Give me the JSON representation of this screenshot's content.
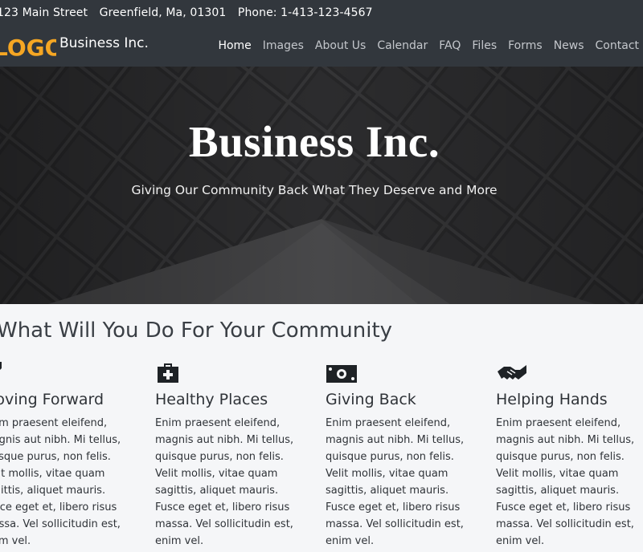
{
  "topbar": {
    "address": "123 Main Street",
    "city": "Greenfield, Ma, 01301",
    "phone": "Phone: 1-413-123-4567"
  },
  "brand": {
    "logo_text": "LOGO",
    "name": "Business Inc."
  },
  "nav": {
    "items": [
      "Home",
      "Images",
      "About Us",
      "Calendar",
      "FAQ",
      "Files",
      "Forms",
      "News",
      "Contact"
    ],
    "active": "Home"
  },
  "hero": {
    "title": "Business Inc.",
    "subtitle": "Giving Our Community Back What They Deserve and More"
  },
  "features": {
    "heading": "What Will You Do For Your Community",
    "items": [
      {
        "icon": "key-icon",
        "title": "Moving Forward",
        "text": "Enim praesent eleifend, magnis aut nibh. Mi tellus, quisque purus, non felis. Velit mollis, vitae quam sagittis, aliquet mauris. Fusce eget et, libero risus massa. Vel sollicitudin est, enim vel."
      },
      {
        "icon": "first-aid-kit-icon",
        "title": "Healthy Places",
        "text": "Enim praesent eleifend, magnis aut nibh. Mi tellus, quisque purus, non felis. Velit mollis, vitae quam sagittis, aliquet mauris. Fusce eget et, libero risus massa. Vel sollicitudin est, enim vel."
      },
      {
        "icon": "money-bill-icon",
        "title": "Giving Back",
        "text": "Enim praesent eleifend, magnis aut nibh. Mi tellus, quisque purus, non felis. Velit mollis, vitae quam sagittis, aliquet mauris. Fusce eget et, libero risus massa. Vel sollicitudin est, enim vel."
      },
      {
        "icon": "handshake-icon",
        "title": "Helping Hands",
        "text": "Enim praesent eleifend, magnis aut nibh. Mi tellus, quisque purus, non felis. Velit mollis, vitae quam sagittis, aliquet mauris. Fusce eget et, libero risus massa. Vel sollicitudin est, enim vel."
      }
    ]
  },
  "colors": {
    "header_bg": "#32373d",
    "logo_accent": "#f5a623",
    "section_bg": "#f5f6f8",
    "text_dark": "#2f3338"
  }
}
